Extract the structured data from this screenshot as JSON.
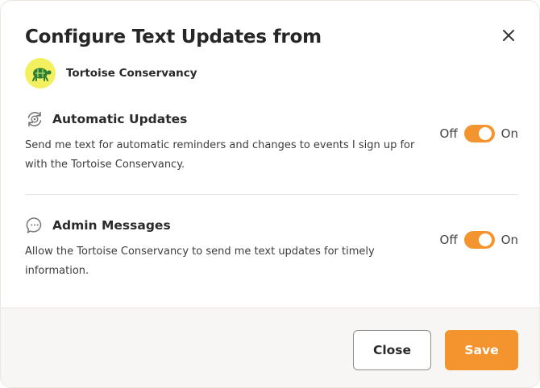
{
  "dialog": {
    "title": "Configure Text Updates from",
    "close_icon": "close-icon"
  },
  "organization": {
    "name": "Tortoise Conservancy",
    "avatar_icon": "tortoise-logo",
    "avatar_color": "#f2f05e"
  },
  "sections": [
    {
      "icon": "automatic-updates-icon",
      "title": "Automatic Updates",
      "description": "Send me text for automatic reminders and changes to events I sign up for with the Tortoise Conservancy.",
      "toggle": {
        "off_label": "Off",
        "on_label": "On",
        "state": "on"
      }
    },
    {
      "icon": "chat-bubble-icon",
      "title": "Admin Messages",
      "description": "Allow the Tortoise Conservancy to send me text updates for timely information.",
      "toggle": {
        "off_label": "Off",
        "on_label": "On",
        "state": "on"
      }
    }
  ],
  "footer": {
    "close_label": "Close",
    "save_label": "Save"
  },
  "colors": {
    "accent": "#f3942f",
    "footer_bg": "#f8f6f4"
  }
}
